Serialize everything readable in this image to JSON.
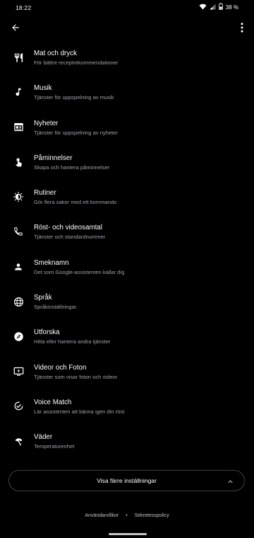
{
  "status": {
    "time": "18:22",
    "battery": "38 %"
  },
  "items": [
    {
      "title": "Mat och dryck",
      "subtitle": "För bättre receptrekommendationer",
      "icon": "fork-knife-icon"
    },
    {
      "title": "Musik",
      "subtitle": "Tjänster för uppspelning av musik",
      "icon": "music-note-icon"
    },
    {
      "title": "Nyheter",
      "subtitle": "Tjänster för uppspelning av nyheter",
      "icon": "newspaper-icon"
    },
    {
      "title": "Påminnelser",
      "subtitle": "Skapa och hantera påminnelser",
      "icon": "reminder-hand-icon"
    },
    {
      "title": "Rutiner",
      "subtitle": "Gör flera saker med ett kommando",
      "icon": "routines-icon"
    },
    {
      "title": "Röst- och videosamtal",
      "subtitle": "Tjänster och standardnummer",
      "icon": "phone-icon"
    },
    {
      "title": "Smeknamn",
      "subtitle": "Det som Google-assistenten kallar dig",
      "icon": "person-icon"
    },
    {
      "title": "Språk",
      "subtitle": "Språkinställningar",
      "icon": "globe-icon"
    },
    {
      "title": "Utforska",
      "subtitle": "Hitta eller hantera andra tjänster",
      "icon": "compass-icon"
    },
    {
      "title": "Videor och Foton",
      "subtitle": "Tjänster som visar foton och videor",
      "icon": "video-screen-icon"
    },
    {
      "title": "Voice Match",
      "subtitle": "Lär assistenten att känna igen din röst",
      "icon": "voice-match-icon"
    },
    {
      "title": "Väder",
      "subtitle": "Temperaturenhet",
      "icon": "umbrella-icon"
    }
  ],
  "less_button": {
    "label": "Visa färre inställningar"
  },
  "footer": {
    "terms": "Användarvillkor",
    "separator": "•",
    "privacy": "Sekretesspolicy"
  }
}
